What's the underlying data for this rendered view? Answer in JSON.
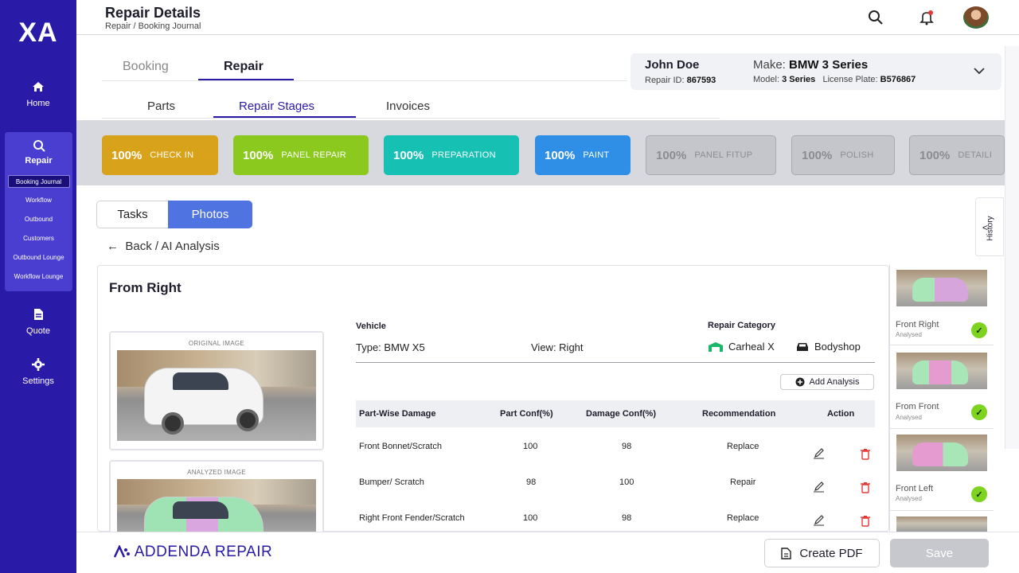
{
  "sidebar": {
    "logo": "XA",
    "home": "Home",
    "repair": "Repair",
    "sub_items": [
      "Booking Journal",
      "Workflow",
      "Outbound",
      "Customers",
      "Outbound Lounge",
      "Workflow Lounge"
    ],
    "quote": "Quote",
    "settings": "Settings"
  },
  "header": {
    "title": "Repair Details",
    "breadcrumb": "Repair / Booking Journal"
  },
  "tabs": {
    "primary": [
      "Booking",
      "Repair"
    ],
    "primary_active": "Repair",
    "secondary": [
      "Parts",
      "Repair Stages",
      "Invoices"
    ],
    "secondary_active": "Repair Stages"
  },
  "customer": {
    "name": "John Doe",
    "repair_id_label": "Repair ID:",
    "repair_id": "867593",
    "make_label": "Make:",
    "make": "BMW 3 Series",
    "model_label": "Model:",
    "model": "3 Series",
    "plate_label": "License Plate:",
    "plate": "B576867"
  },
  "stages": [
    {
      "pct": "100%",
      "label": "CHECK IN",
      "color": "#d9a21b",
      "active": true
    },
    {
      "pct": "100%",
      "label": "PANEL REPAIR",
      "color": "#8bc91e",
      "active": true
    },
    {
      "pct": "100%",
      "label": "PREPARATION",
      "color": "#16c1b3",
      "active": true
    },
    {
      "pct": "100%",
      "label": "PAINT",
      "color": "#2f8fe6",
      "active": true
    },
    {
      "pct": "100%",
      "label": "PANEL FITUP",
      "active": false
    },
    {
      "pct": "100%",
      "label": "POLISH",
      "active": false
    },
    {
      "pct": "100%",
      "label": "DETAILI",
      "active": false
    }
  ],
  "segment": {
    "tasks": "Tasks",
    "photos": "Photos"
  },
  "back_link": "Back / AI Analysis",
  "panel": {
    "title": "From Right",
    "original_caption": "ORIGINAL IMAGE",
    "analyzed_caption": "ANALYZED IMAGE",
    "vehicle_label": "Vehicle",
    "type_text": "Type: BMW X5",
    "view_text": "View: Right",
    "category_label": "Repair Category",
    "cat1": "Carheal X",
    "cat2": "Bodyshop",
    "add_analysis": "Add Analysis"
  },
  "table": {
    "headers": [
      "Part-Wise Damage",
      "Part Conf(%)",
      "Damage Conf(%)",
      "Recommendation",
      "Action"
    ],
    "rows": [
      {
        "part": "Front Bonnet/Scratch",
        "part_conf": "100",
        "damage_conf": "98",
        "rec": "Replace"
      },
      {
        "part": "Bumper/ Scratch",
        "part_conf": "98",
        "damage_conf": "100",
        "rec": "Repair"
      },
      {
        "part": "Right Front Fender/Scratch",
        "part_conf": "100",
        "damage_conf": "98",
        "rec": "Replace"
      }
    ]
  },
  "thumbnails": [
    {
      "label": "Front Right",
      "status": "Analysed"
    },
    {
      "label": "From Front",
      "status": "Analysed"
    },
    {
      "label": "Front Left",
      "status": "Analysed"
    }
  ],
  "history": "History",
  "footer": {
    "brand": "ADDENDA REPAIR",
    "create_pdf": "Create PDF",
    "save": "Save"
  },
  "colors": {
    "brand": "#2a1aa8",
    "check": "#7ed321",
    "delete": "#e53935"
  }
}
